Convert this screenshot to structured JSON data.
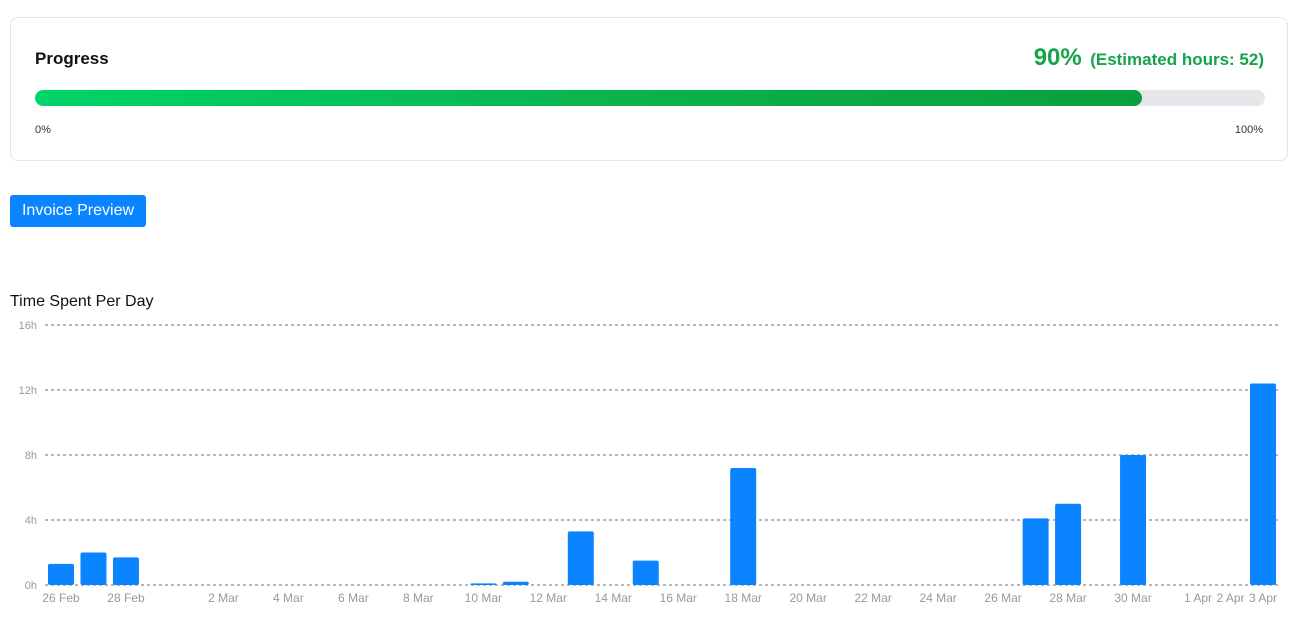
{
  "progress": {
    "label": "Progress",
    "percent_text": "90%",
    "estimated_text": "(Estimated hours: 52)",
    "fraction": 0.9,
    "min_label": "0%",
    "max_label": "100%",
    "color": "#16a34a"
  },
  "actions": {
    "invoice_label": "Invoice Preview"
  },
  "chart_data": {
    "type": "bar",
    "title": "Time Spent Per Day",
    "xlabel": "",
    "ylabel": "",
    "ylim": [
      0,
      16
    ],
    "yticks": [
      0,
      4,
      8,
      12,
      16
    ],
    "ytick_labels": [
      "0h",
      "4h",
      "8h",
      "12h",
      "16h"
    ],
    "grid": true,
    "bar_color": "#0a84ff",
    "x_tick_labels": [
      "26 Feb",
      "28 Feb",
      "2 Mar",
      "4 Mar",
      "6 Mar",
      "8 Mar",
      "10 Mar",
      "12 Mar",
      "14 Mar",
      "16 Mar",
      "18 Mar",
      "20 Mar",
      "22 Mar",
      "24 Mar",
      "26 Mar",
      "28 Mar",
      "30 Mar",
      "1 Apr",
      "2 Apr",
      "3 Apr"
    ],
    "categories": [
      "26 Feb",
      "27 Feb",
      "28 Feb",
      "10 Mar",
      "11 Mar",
      "13 Mar",
      "15 Mar",
      "18 Mar",
      "27 Mar",
      "28 Mar",
      "30 Mar",
      "3 Apr"
    ],
    "values": [
      1.3,
      2.0,
      1.7,
      0.1,
      0.2,
      3.3,
      1.5,
      7.2,
      4.1,
      5.0,
      8.0,
      12.4
    ]
  }
}
